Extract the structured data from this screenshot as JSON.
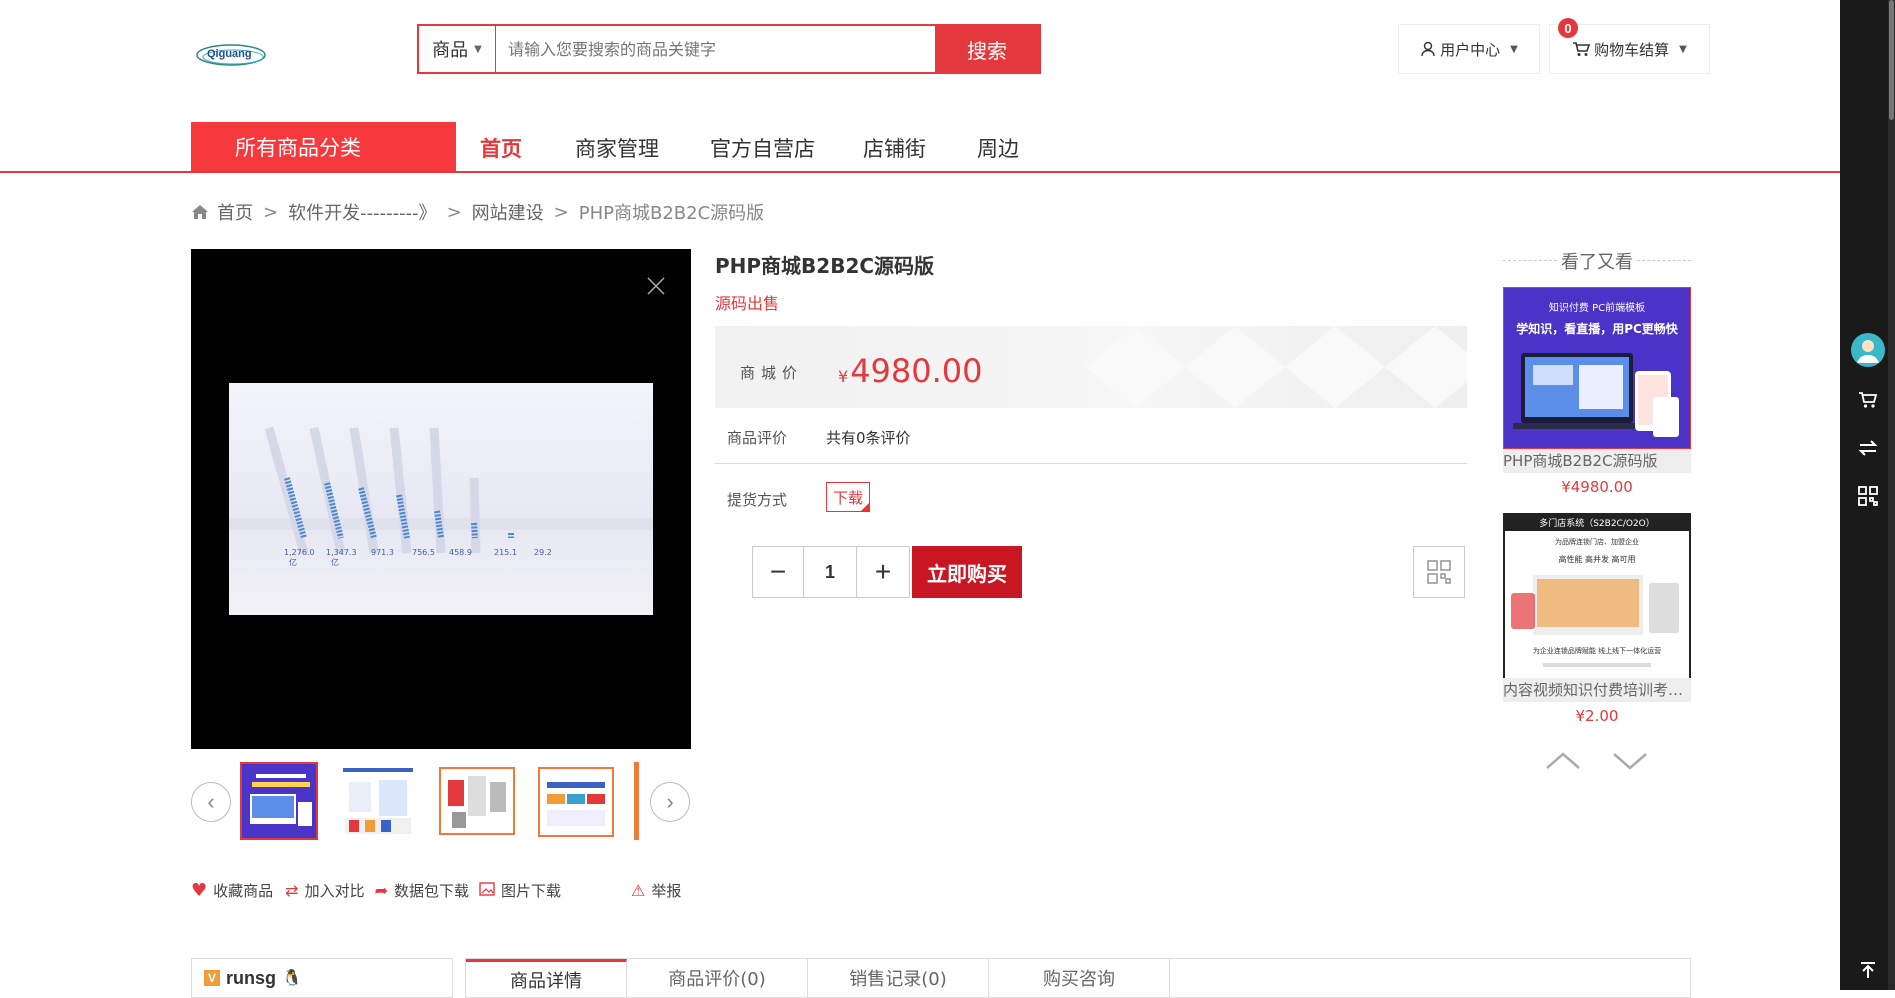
{
  "colors": {
    "accent": "#e4393c",
    "buy": "#c81623",
    "sidebar": "#1a1a1a"
  },
  "header": {
    "logo_text": "Qiguang",
    "search": {
      "category": "商品",
      "placeholder": "请输入您要搜索的商品关键字",
      "button": "搜索"
    },
    "user_center": "用户中心",
    "cart": "购物车结算",
    "cart_count": "0"
  },
  "nav": {
    "all_categories": "所有商品分类",
    "items": [
      "首页",
      "商家管理",
      "官方自营店",
      "店铺街",
      "周边"
    ]
  },
  "breadcrumb": [
    "首页",
    "软件开发---------》",
    "网站建设",
    "PHP商城B2B2C源码版"
  ],
  "gallery": {
    "chart_values": [
      "1,276.0",
      "1,347.3",
      "971.3",
      "756.5",
      "458.9",
      "215.1",
      "29.2"
    ],
    "chart_units": "亿"
  },
  "actions": {
    "favorite": "收藏商品",
    "compare": "加入对比",
    "download_pkg": "数据包下载",
    "image_download": "图片下载",
    "report": "举报"
  },
  "product": {
    "title": "PHP商城B2B2C源码版",
    "subtitle": "源码出售",
    "price_label": "商城价",
    "currency": "¥",
    "price": "4980.00",
    "review_label": "商品评价",
    "review_value": "共有0条评价",
    "delivery_label": "提货方式",
    "delivery_option": "下载",
    "quantity": "1",
    "buy_button": "立即购买"
  },
  "recommend": {
    "title": "看了又看",
    "items": [
      {
        "name": "PHP商城B2B2C源码版",
        "price": "¥4980.00",
        "banner_small": "知识付费 PC前端模板",
        "banner_big": "学知识，看直播，用PC更畅快"
      },
      {
        "name": "内容视频知识付费培训考试系统",
        "price": "¥2.00",
        "banner_small": "多门店系统（S2B2C/O2O）",
        "banner_mid": "为品牌连锁门店、加盟企业",
        "banner_tags": "高性能  高并发  高可用",
        "banner_foot": "为企业连锁品牌赋能  线上线下一体化运营"
      }
    ]
  },
  "bottom": {
    "shop_name": "runsg",
    "tabs": [
      "商品详情",
      "商品评价(0)",
      "销售记录(0)",
      "购买咨询"
    ]
  }
}
